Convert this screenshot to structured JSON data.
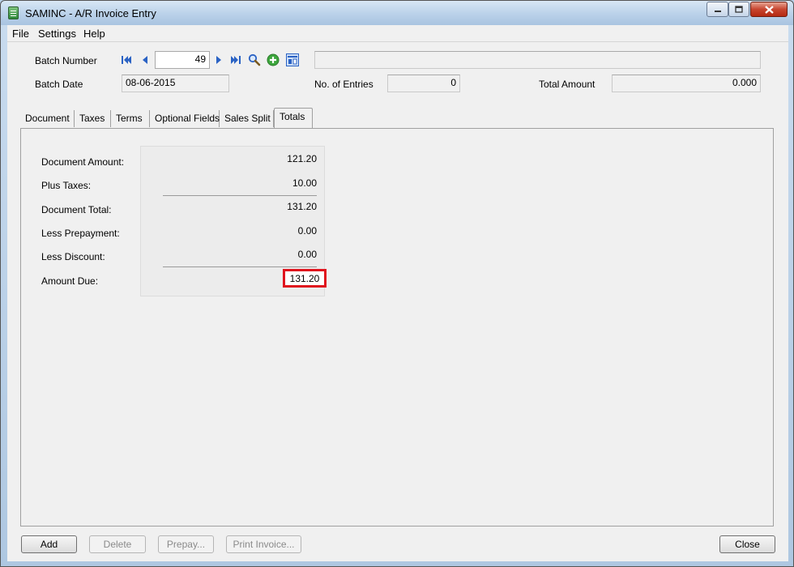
{
  "window": {
    "title": "SAMINC - A/R Invoice Entry",
    "icon": "invoice-app-icon"
  },
  "menu": {
    "file": "File",
    "settings": "Settings",
    "help": "Help"
  },
  "header": {
    "batch_number_label": "Batch Number",
    "batch_number_value": "49",
    "batch_description": "",
    "batch_date_label": "Batch Date",
    "batch_date_value": "08-06-2015",
    "entries_label": "No. of Entries",
    "entries_value": "0",
    "total_amount_label": "Total Amount",
    "total_amount_value": "0.000"
  },
  "tabs": [
    {
      "label": "Document",
      "active": false
    },
    {
      "label": "Taxes",
      "active": false
    },
    {
      "label": "Terms",
      "active": false
    },
    {
      "label": "Optional Fields",
      "active": false
    },
    {
      "label": "Sales Split",
      "active": false
    },
    {
      "label": "Totals",
      "active": true
    }
  ],
  "totals": {
    "document_amount_label": "Document Amount:",
    "document_amount_value": "121.20",
    "plus_taxes_label": "Plus Taxes:",
    "plus_taxes_value": "10.00",
    "document_total_label": "Document Total:",
    "document_total_value": "131.20",
    "less_prepayment_label": "Less Prepayment:",
    "less_prepayment_value": "0.00",
    "less_discount_label": "Less Discount:",
    "less_discount_value": "0.00",
    "amount_due_label": "Amount Due:",
    "amount_due_value": "131.20"
  },
  "buttons": {
    "add": "Add",
    "delete": "Delete",
    "prepay": "Prepay...",
    "print_invoice": "Print Invoice...",
    "close": "Close"
  },
  "colors": {
    "highlight": "#e0141e",
    "nav_arrow": "#2a62c4",
    "new_icon": "#3da63d"
  }
}
